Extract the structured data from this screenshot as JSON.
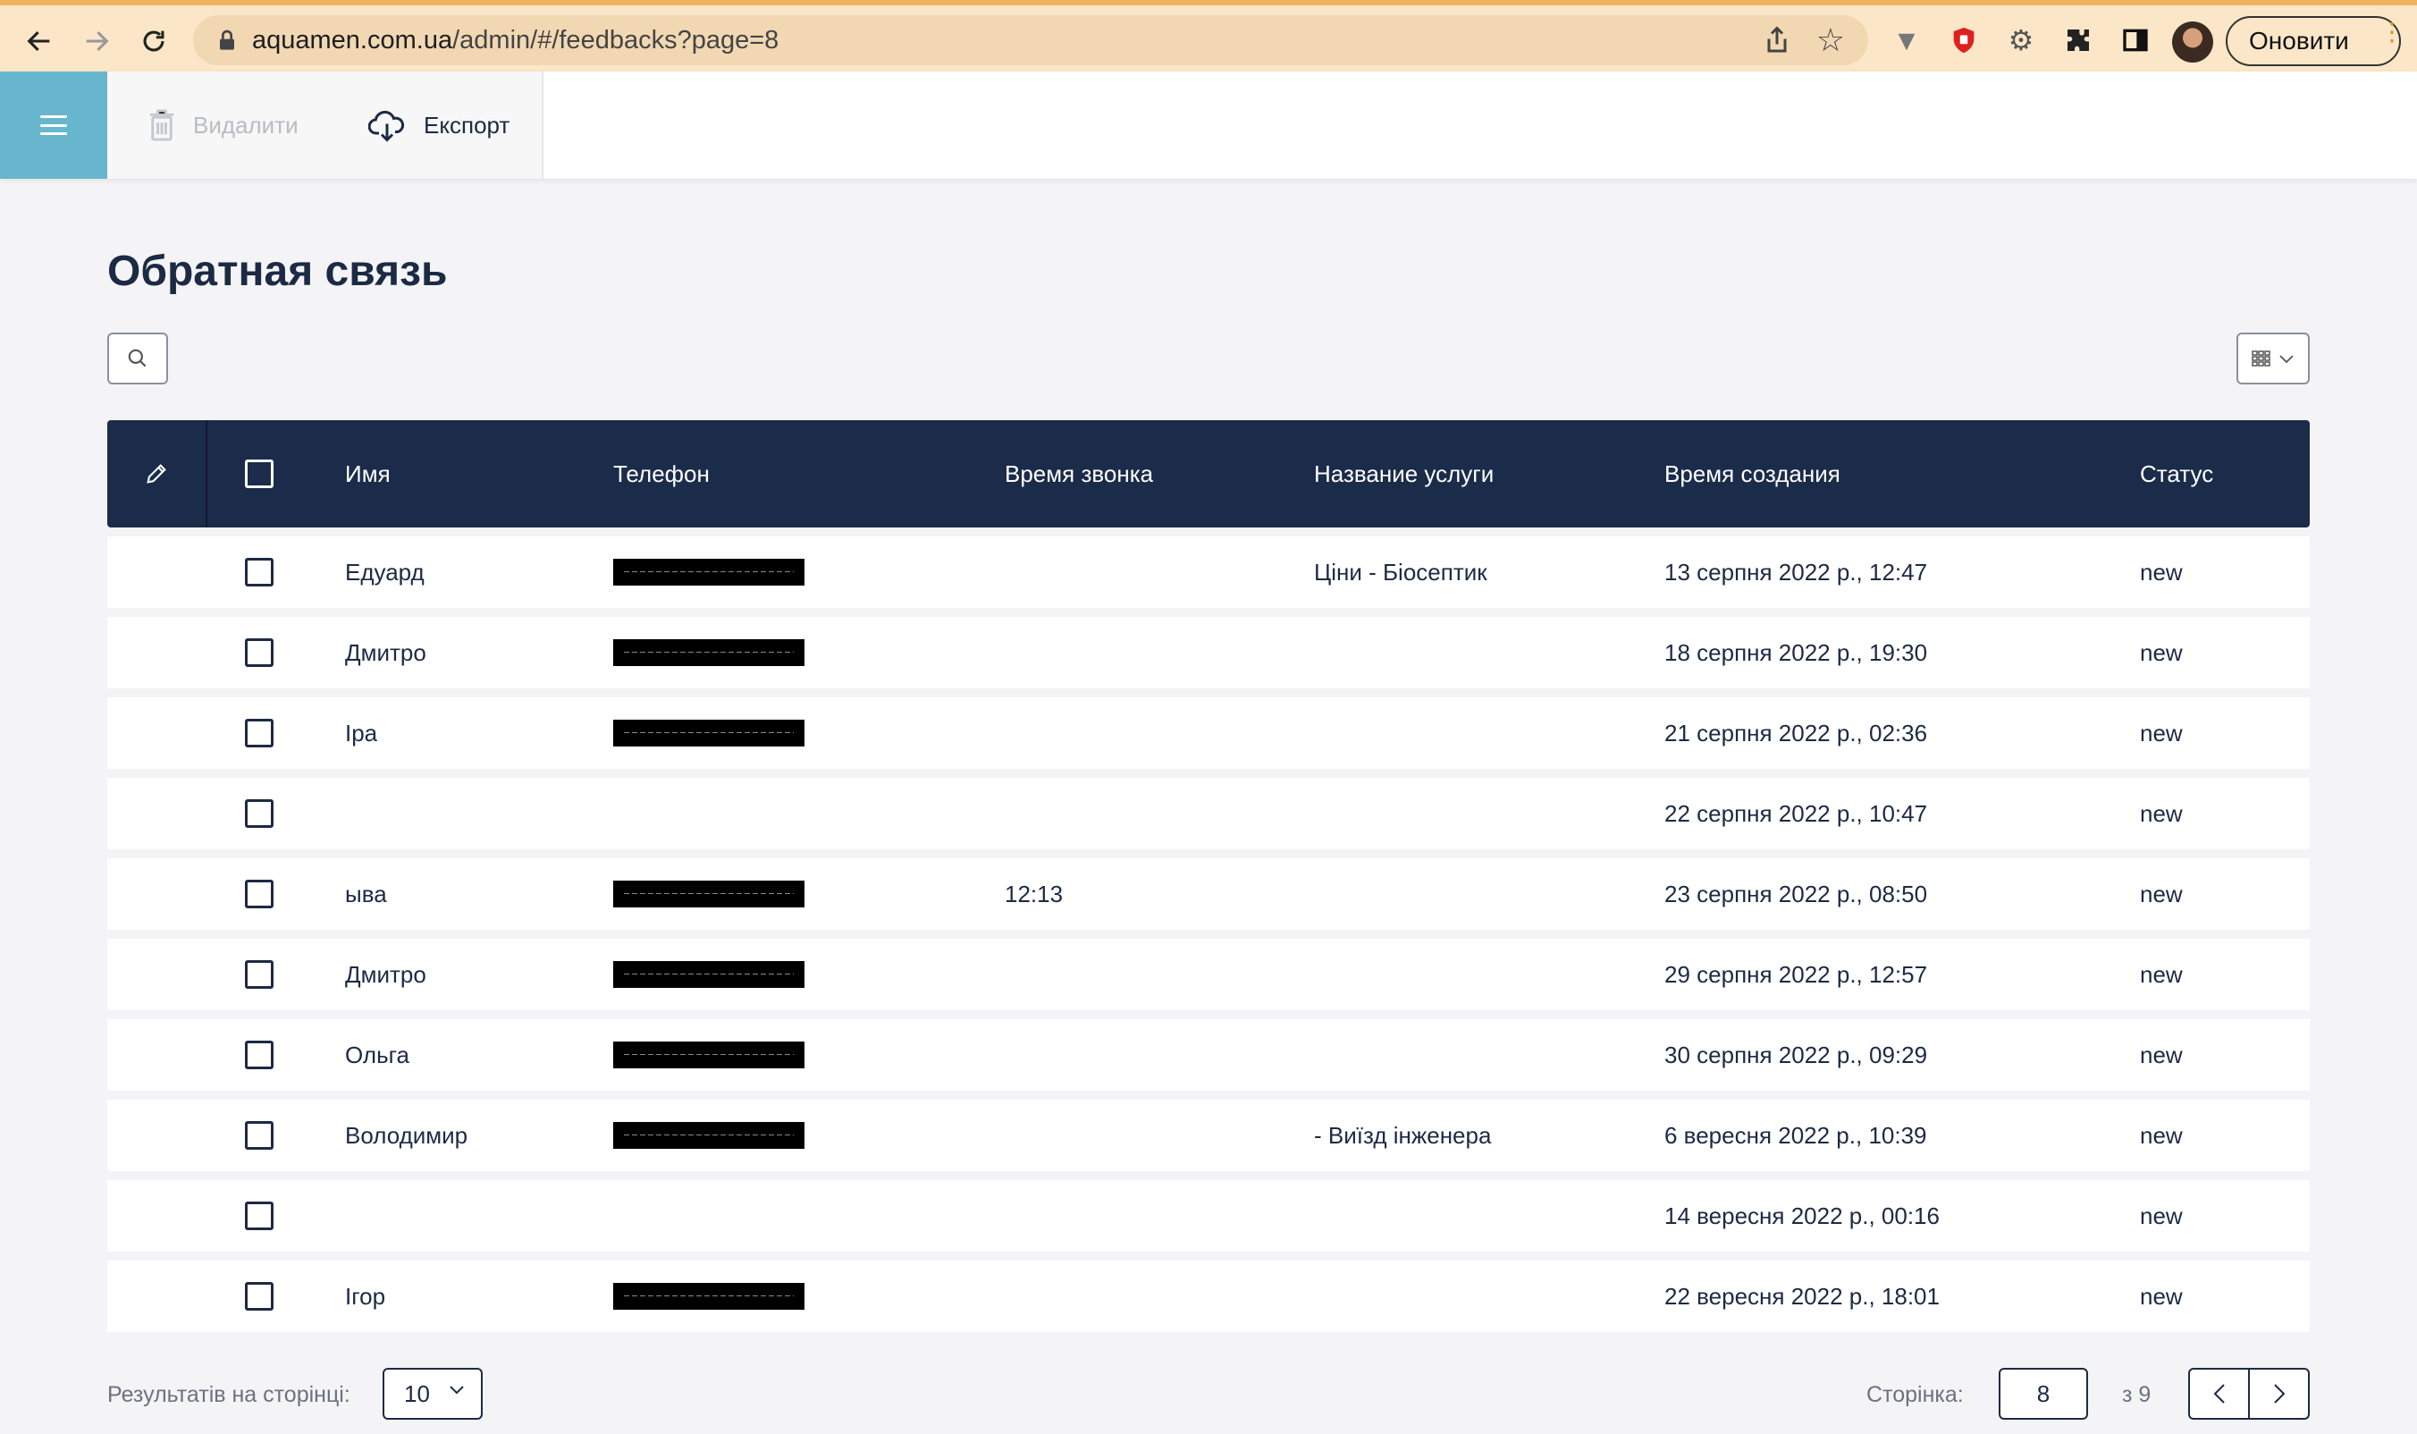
{
  "browser": {
    "url_host": "aquamen.com.ua",
    "url_path": "/admin/#/feedbacks?page=8",
    "update_label": "Оновити"
  },
  "toolbar": {
    "delete_label": "Видалити",
    "export_label": "Експорт"
  },
  "page": {
    "title": "Обратная связь"
  },
  "table": {
    "headers": {
      "name": "Имя",
      "phone": "Телефон",
      "call_time": "Время звонка",
      "service": "Название услуги",
      "created": "Время создания",
      "status": "Статус"
    },
    "rows": [
      {
        "name": "Едуард",
        "phone_redacted": true,
        "call_time": "",
        "service": "Ціни - Біосептик",
        "created": "13 серпня 2022 р., 12:47",
        "status": "new"
      },
      {
        "name": "Дмитро",
        "phone_redacted": true,
        "call_time": "",
        "service": "",
        "created": "18 серпня 2022 р., 19:30",
        "status": "new"
      },
      {
        "name": "Іра",
        "phone_redacted": true,
        "call_time": "",
        "service": "",
        "created": "21 серпня 2022 р., 02:36",
        "status": "new"
      },
      {
        "name": "",
        "phone_redacted": false,
        "call_time": "",
        "service": "",
        "created": "22 серпня 2022 р., 10:47",
        "status": "new"
      },
      {
        "name": "ыва",
        "phone_redacted": true,
        "call_time": "12:13",
        "service": "",
        "created": "23 серпня 2022 р., 08:50",
        "status": "new"
      },
      {
        "name": "Дмитро",
        "phone_redacted": true,
        "call_time": "",
        "service": "",
        "created": "29 серпня 2022 р., 12:57",
        "status": "new"
      },
      {
        "name": "Ольга",
        "phone_redacted": true,
        "call_time": "",
        "service": "",
        "created": "30 серпня 2022 р., 09:29",
        "status": "new"
      },
      {
        "name": "Володимир",
        "phone_redacted": true,
        "call_time": "",
        "service": "- Виїзд інженера",
        "created": "6 вересня 2022 р., 10:39",
        "status": "new"
      },
      {
        "name": "",
        "phone_redacted": false,
        "call_time": "",
        "service": "",
        "created": "14 вересня 2022 р., 00:16",
        "status": "new"
      },
      {
        "name": "Ігор",
        "phone_redacted": true,
        "call_time": "",
        "service": "",
        "created": "22 вересня 2022 р., 18:01",
        "status": "new"
      }
    ]
  },
  "pagination": {
    "per_page_label": "Результатів на сторінці:",
    "per_page_value": "10",
    "page_label": "Сторінка:",
    "current_page": "8",
    "total_label": "з 9"
  },
  "colors": {
    "accent": "#67b6cd",
    "header_bg": "#1b2b4a",
    "chrome_bg": "#fbe7c8"
  }
}
